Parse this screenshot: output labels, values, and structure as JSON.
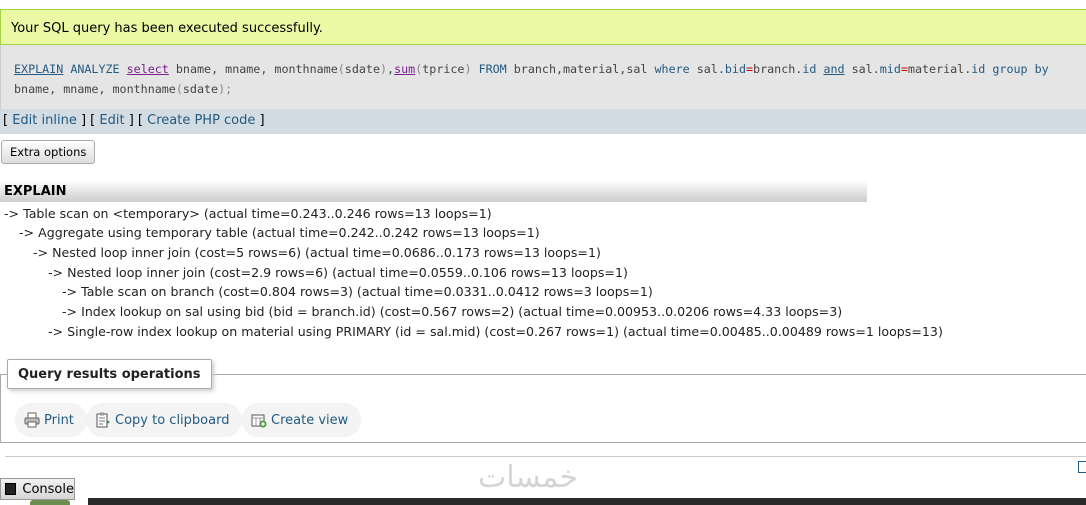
{
  "message": {
    "text": "Your SQL query has been executed successfully."
  },
  "sql": {
    "t1": "EXPLAIN",
    "t2": "ANALYZE",
    "t3": "select",
    "t4": " bname, mname, monthname",
    "t5": "(",
    "t6": "sdate",
    "t7": ")",
    "t8": ",",
    "t9": "sum",
    "t10": "(",
    "t11": "tprice",
    "t12": ")",
    "t13": " FROM",
    "t14": " branch,material,sal ",
    "t15": "where",
    "t16": " sal.",
    "t17": "bid",
    "t18": "=",
    "t19": "branch.",
    "t20": "id",
    "t21": " ",
    "t22": "and",
    "t23": " sal.",
    "t24": "mid",
    "t25": "=",
    "t26": "material.",
    "t27": "id",
    "t28": " ",
    "t29": "group by",
    "t30": " bname, mname, monthname",
    "t31": "(",
    "t32": "sdate",
    "t33": ");"
  },
  "links": {
    "open1": "[ ",
    "edit_inline": "Edit inline",
    "sep1": " ] [ ",
    "edit": "Edit",
    "sep2": " ] [ ",
    "create_php": "Create PHP code",
    "close": " ]"
  },
  "extra_options": "Extra options",
  "explain": {
    "heading": "EXPLAIN",
    "lines": [
      "-> Table scan on <temporary>  (actual time=0.243..0.246 rows=13 loops=1)",
      "-> Aggregate using temporary table  (actual time=0.242..0.242 rows=13 loops=1)",
      "-> Nested loop inner join  (cost=5 rows=6) (actual time=0.0686..0.173 rows=13 loops=1)",
      "-> Nested loop inner join  (cost=2.9 rows=6) (actual time=0.0559..0.106 rows=13 loops=1)",
      "-> Table scan on branch  (cost=0.804 rows=3) (actual time=0.0331..0.0412 rows=3 loops=1)",
      "-> Index lookup on sal using bid (bid = branch.id)  (cost=0.567 rows=2) (actual time=0.00953..0.0206 rows=4.33 loops=3)",
      "-> Single-row index lookup on material using PRIMARY (id = sal.mid)  (cost=0.267 rows=1) (actual time=0.00485..0.00489 rows=1 loops=13)"
    ]
  },
  "operations": {
    "legend": "Query results operations",
    "print": "Print",
    "copy": "Copy to clipboard",
    "create_view": "Create view"
  },
  "console": {
    "label": "Console"
  },
  "watermark": "خمسات",
  "icons": [
    "print-icon",
    "clipboard-icon",
    "create-view-icon",
    "console-icon"
  ]
}
